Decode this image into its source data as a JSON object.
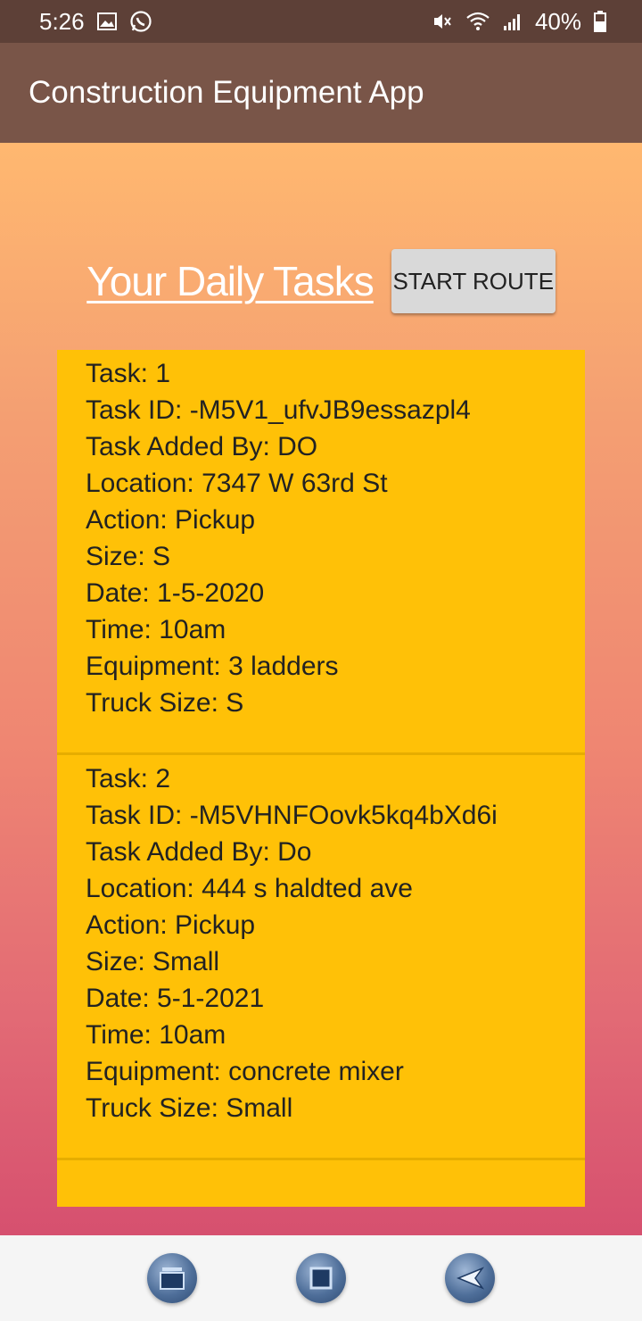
{
  "status_bar": {
    "time": "5:26",
    "battery": "40%",
    "icons": [
      "image-icon",
      "whatsapp-icon",
      "mute-icon",
      "wifi-icon",
      "signal-icon",
      "battery-icon"
    ]
  },
  "app_bar": {
    "title": "Construction Equipment App"
  },
  "main": {
    "heading": "Your Daily Tasks",
    "start_route_label": "START ROUTE"
  },
  "tasks": [
    {
      "lines": [
        "Task: 1",
        "Task ID: -M5V1_ufvJB9essazpl4",
        "Task Added By: DO",
        "Location: 7347 W 63rd St",
        "Action: Pickup",
        "Size: S",
        "Date: 1-5-2020",
        "Time: 10am",
        "Equipment: 3 ladders",
        "Truck Size: S"
      ]
    },
    {
      "lines": [
        "Task: 2",
        "Task ID: -M5VHNFOovk5kq4bXd6i",
        "Task Added By: Do",
        "Location: 444 s haldted ave",
        "Action: Pickup",
        "Size: Small",
        "Date: 5-1-2021",
        "Time: 10am",
        "Equipment: concrete mixer",
        "Truck Size: Small"
      ]
    }
  ],
  "nav_bar": {
    "icons": [
      "recent-apps-icon",
      "home-icon",
      "back-icon"
    ]
  },
  "colors": {
    "status_bar": "#5d4037",
    "app_bar": "#795548",
    "task_card": "#ffc107",
    "gradient_top": "#ffb870",
    "gradient_bottom": "#d6506f"
  }
}
